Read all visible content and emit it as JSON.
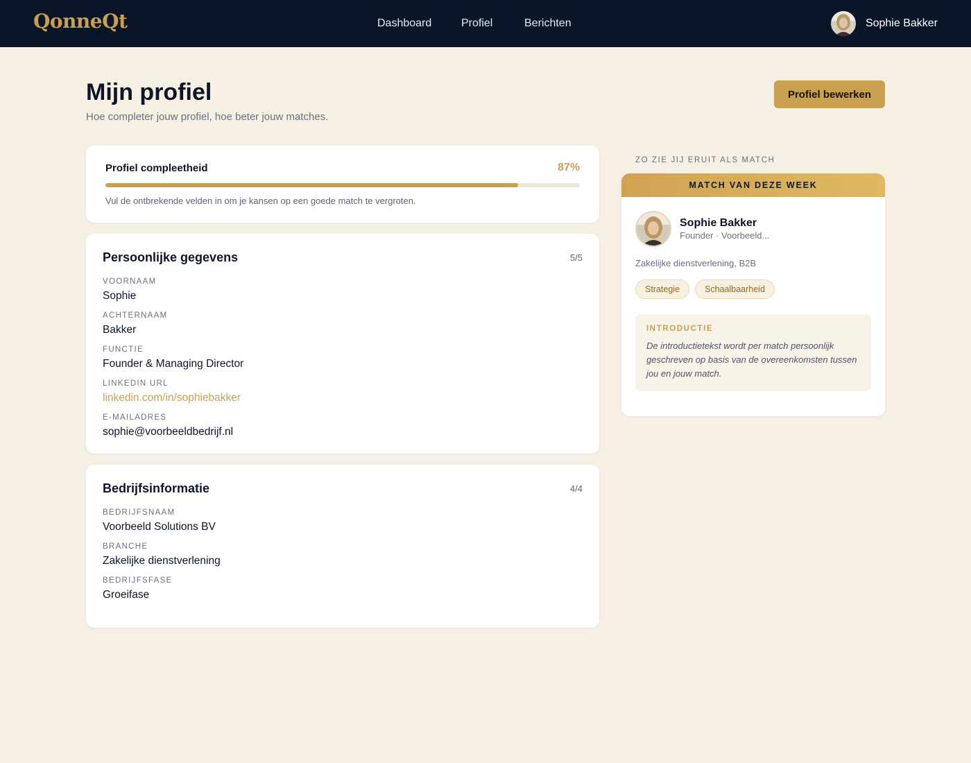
{
  "app": {
    "logo": "QonneQt"
  },
  "nav": {
    "links": [
      "Dashboard",
      "Profiel",
      "Berichten"
    ]
  },
  "user": {
    "name": "Sophie Bakker"
  },
  "header": {
    "title": "Mijn profiel",
    "subtitle": "Hoe completer jouw profiel, hoe beter jouw matches.",
    "edit_button": "Profiel bewerken"
  },
  "completeness": {
    "title": "Profiel compleetheid",
    "percent_label": "87%",
    "fraction": 0.87,
    "hint": "Vul de ontbrekende velden in om je kansen op een goede match te vergroten."
  },
  "personal": {
    "title": "Persoonlijke gegevens",
    "count": "5/5",
    "fields": [
      {
        "label": "Voornaam",
        "value": "Sophie"
      },
      {
        "label": "Achternaam",
        "value": "Bakker"
      },
      {
        "label": "Functie",
        "value": "Founder & Managing Director"
      },
      {
        "label": "LinkedIn URL",
        "value": "linkedin.com/in/sophiebakker"
      },
      {
        "label": "E-mailadres",
        "value": "sophie@voorbeeldbedrijf.nl"
      }
    ]
  },
  "company": {
    "title": "Bedrijfsinformatie",
    "count": "4/4",
    "fields": [
      {
        "label": "Bedrijfsnaam",
        "value": "Voorbeeld Solutions BV"
      },
      {
        "label": "Branche",
        "value": "Zakelijke dienstverlening"
      },
      {
        "label": "Bedrijfsfase",
        "value": "Groeifase"
      }
    ]
  },
  "preview": {
    "caption": "ZO ZIE JIJ ERUIT ALS MATCH",
    "banner": "MATCH VAN DEZE WEEK",
    "name": "Sophie Bakker",
    "role": "Founder · Voorbeeld...",
    "sector": "Zakelijke dienstverlening, B2B",
    "tags": [
      "Strategie",
      "Schaalbaarheid"
    ],
    "intro_label": "INTRODUCTIE",
    "intro_text": "De introductietekst wordt per match persoonlijk geschreven op basis van de overeenkomsten tussen jou en jouw match."
  },
  "colors": {
    "accent": "#c9a04f",
    "navbar": "#0b1528",
    "background": "#f5efe4"
  }
}
